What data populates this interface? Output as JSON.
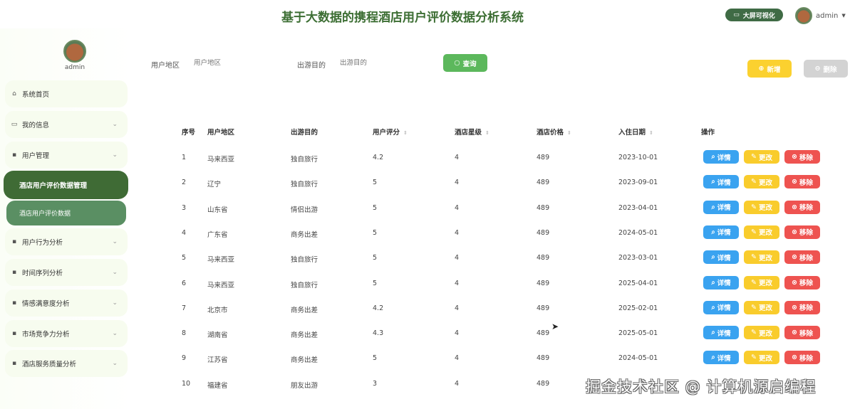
{
  "header": {
    "title": "基于大数据的携程酒店用户评价数据分析系统",
    "bigscreen_label": "大屏可视化",
    "user": "admin"
  },
  "sidebar": {
    "user": "admin",
    "items": [
      {
        "label": "系统首页",
        "icon": "home-icon"
      },
      {
        "label": "我的信息",
        "icon": "card-icon"
      },
      {
        "label": "用户管理",
        "icon": "grid-icon"
      },
      {
        "label": "酒店用户评价数据管理"
      },
      {
        "label": "酒店用户评价数据"
      },
      {
        "label": "用户行为分析",
        "icon": "grid-icon"
      },
      {
        "label": "时间序列分析",
        "icon": "grid-icon"
      },
      {
        "label": "情感满意度分析",
        "icon": "grid-icon"
      },
      {
        "label": "市场竞争力分析",
        "icon": "grid-icon"
      },
      {
        "label": "酒店服务质量分析",
        "icon": "grid-icon"
      }
    ]
  },
  "search": {
    "region_label": "用户地区",
    "region_placeholder": "用户地区",
    "purpose_label": "出游目的",
    "purpose_placeholder": "出游目的",
    "query_label": "查询"
  },
  "toolbar": {
    "add_label": "新增",
    "delete_label": "删除"
  },
  "table": {
    "headers": [
      "序号",
      "用户地区",
      "出游目的",
      "用户评分",
      "酒店星级",
      "酒店价格",
      "入住日期",
      "操作"
    ],
    "actions": {
      "detail": "详情",
      "edit": "更改",
      "remove": "移除"
    },
    "rows": [
      [
        "1",
        "马来西亚",
        "独自旅行",
        "4.2",
        "4",
        "489",
        "2023-10-01"
      ],
      [
        "2",
        "辽宁",
        "独自旅行",
        "5",
        "4",
        "489",
        "2023-09-01"
      ],
      [
        "3",
        "山东省",
        "情侣出游",
        "5",
        "4",
        "489",
        "2023-04-01"
      ],
      [
        "4",
        "广东省",
        "商务出差",
        "5",
        "4",
        "489",
        "2024-05-01"
      ],
      [
        "5",
        "马来西亚",
        "独自旅行",
        "5",
        "4",
        "489",
        "2023-03-01"
      ],
      [
        "6",
        "马来西亚",
        "独自旅行",
        "5",
        "4",
        "489",
        "2025-04-01"
      ],
      [
        "7",
        "北京市",
        "商务出差",
        "4.2",
        "4",
        "489",
        "2025-02-01"
      ],
      [
        "8",
        "湖南省",
        "商务出差",
        "4.3",
        "4",
        "489",
        "2025-05-01"
      ],
      [
        "9",
        "江苏省",
        "商务出差",
        "5",
        "4",
        "489",
        "2024-05-01"
      ],
      [
        "10",
        "福建省",
        "朋友出游",
        "3",
        "4",
        "489",
        ""
      ]
    ]
  },
  "watermark": "掘金技术社区 @ 计算机源启编程",
  "colors": {
    "primary": "#3f6b35",
    "detail": "#3aa3f0",
    "edit": "#f9cc2c",
    "remove": "#ee5350",
    "query": "#5cb85c"
  }
}
